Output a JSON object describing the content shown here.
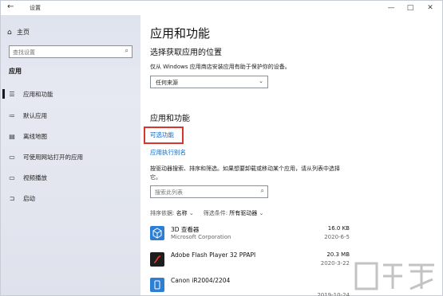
{
  "window": {
    "title": "设置",
    "back_icon": "back-arrow-icon",
    "controls": {
      "minimize": "—",
      "maximize": "□",
      "close": "✕"
    }
  },
  "sidebar": {
    "home_label": "主页",
    "search_placeholder": "查找设置",
    "section_label": "应用",
    "items": [
      {
        "label": "应用和功能",
        "icon": "list-icon",
        "active": true
      },
      {
        "label": "默认应用",
        "icon": "default-apps-icon",
        "active": false
      },
      {
        "label": "离线地图",
        "icon": "map-icon",
        "active": false
      },
      {
        "label": "可使用网站打开的应用",
        "icon": "website-apps-icon",
        "active": false
      },
      {
        "label": "视频播放",
        "icon": "video-icon",
        "active": false
      },
      {
        "label": "启动",
        "icon": "startup-icon",
        "active": false
      }
    ]
  },
  "main": {
    "page_title": "应用和功能",
    "install_section": {
      "title": "选择获取应用的位置",
      "description": "仅从 Windows 应用商店安装应用有助于保护你的设备。",
      "select_value": "任何来源"
    },
    "apps_section": {
      "title": "应用和功能",
      "optional_features_link": "可选功能",
      "app_aliases_link": "应用执行别名",
      "description": "按驱动器搜索、排序和筛选。如果想要卸载或移动某个应用，请从列表中选择它。",
      "search_placeholder": "搜索此列表",
      "sort_label": "排序依据:",
      "sort_value": "名称",
      "filter_label": "筛选条件:",
      "filter_value": "所有驱动器",
      "apps": [
        {
          "name": "3D 查看器",
          "publisher": "Microsoft Corporation",
          "size": "16.0 KB",
          "date": "2020-6-5",
          "icon": "3d-viewer-icon"
        },
        {
          "name": "Adobe Flash Player 32 PPAPI",
          "publisher": "",
          "size": "20.3 MB",
          "date": "2020-3-22",
          "icon": "flash-player-icon"
        },
        {
          "name": "Canon iR2004/2204",
          "publisher": "",
          "size": "",
          "date": "2019-10-24",
          "icon": "canon-printer-icon"
        }
      ]
    }
  },
  "colors": {
    "link": "#0b63c1",
    "highlight_box": "#d6362c",
    "sidebar_bg": "#e2e5ee",
    "accent_blue": "#2d7fd6"
  }
}
